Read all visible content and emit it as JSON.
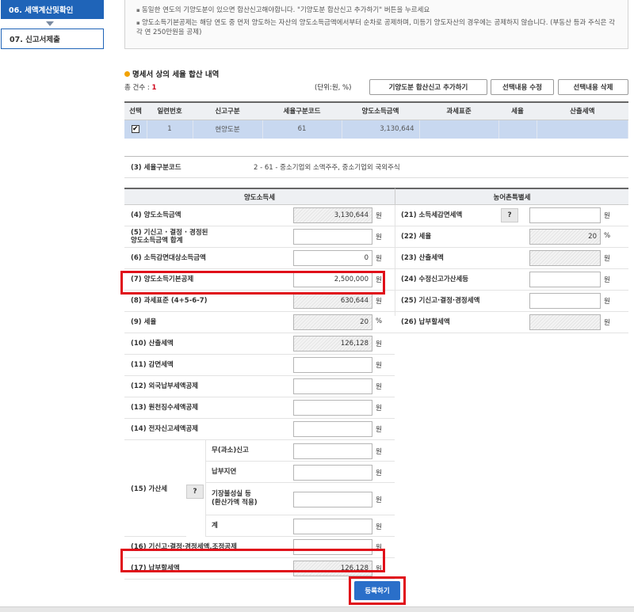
{
  "sidebar": {
    "step_active": "06. 세액계산및확인",
    "step_next": "07. 신고서제출"
  },
  "notice": {
    "line1": "동일한 연도의 기양도분이 있으면 합산신고해야합니다. \"기양도분 합산신고 추가하기\" 버튼을 누르세요",
    "line2": "양도소득기본공제는 해당 연도 중 먼저 양도하는 자산의 양도소득금액에서부터 순차로 공제하며, 미등기 양도자산의 경우에는 공제하지 않습니다. (부동산 등과 주식은 각각 연 250만원을 공제)"
  },
  "section": {
    "title": "명세서 상의 세율 합산 내역",
    "count_label": "총 건수 : ",
    "count_value": "1",
    "unit": "(단위:원, %)"
  },
  "buttons": {
    "add_prior": "기양도분 합산신고 추가하기",
    "edit_selected": "선택내용 수정",
    "delete_selected": "선택내용 삭제",
    "register": "등록하기"
  },
  "list": {
    "headers": [
      "선택",
      "일련번호",
      "신고구분",
      "세율구분코드",
      "양도소득금액",
      "과세표준",
      "세율",
      "산출세액"
    ],
    "row": {
      "checked": "✔",
      "serial": "1",
      "type": "현양도분",
      "rate_code": "61",
      "income": "3,130,644",
      "tax_base": "",
      "rate": "",
      "calc_tax": ""
    }
  },
  "rate_code_row": {
    "label": "(3) 세율구분코드",
    "value": "2 - 61 - 중소기업외 소액주주, 중소기업외 국외주식"
  },
  "form": {
    "left_header": "양도소득세",
    "right_header": "농어촌특별세",
    "won": "원",
    "pct": "%",
    "q": "?",
    "left": [
      {
        "label": "(4) 양도소득금액",
        "value": "3,130,644",
        "unit": "원",
        "ro": true
      },
      {
        "label": "(5) 기신고 · 결정 · 경정된\n양도소득금액 합계",
        "value": "",
        "unit": "원",
        "ro": false
      },
      {
        "label": "(6) 소득감면대상소득금액",
        "value": "0",
        "unit": "원",
        "ro": false
      },
      {
        "label": "(7) 양도소득기본공제",
        "value": "2,500,000",
        "unit": "원",
        "ro": false
      },
      {
        "label": "(8) 과세표준 (4+5-6-7)",
        "value": "630,644",
        "unit": "원",
        "ro": true
      },
      {
        "label": "(9) 세율",
        "value": "20",
        "unit": "%",
        "ro": true
      },
      {
        "label": "(10) 산출세액",
        "value": "126,128",
        "unit": "원",
        "ro": true
      },
      {
        "label": "(11) 감면세액",
        "value": "",
        "unit": "원",
        "ro": false
      },
      {
        "label": "(12) 외국납부세액공제",
        "value": "",
        "unit": "원",
        "ro": false
      },
      {
        "label": "(13) 원천징수세액공제",
        "value": "",
        "unit": "원",
        "ro": false
      },
      {
        "label": "(14) 전자신고세액공제",
        "value": "",
        "unit": "원",
        "ro": false
      }
    ],
    "penalty": {
      "label": "(15) 가산세",
      "items": [
        "무(과소)신고",
        "납부지연",
        "기장불성실 등\n(환산가액 적용)",
        "계"
      ]
    },
    "left_tail": [
      {
        "label": "(16) 기신고·결정·경정세액,조정공제",
        "value": "",
        "unit": "원",
        "ro": false
      },
      {
        "label": "(17) 납부할세액",
        "value": "126,128",
        "unit": "원",
        "ro": true
      }
    ],
    "right": [
      {
        "label": "(21) 소득세감면세액",
        "value": "",
        "unit": "원",
        "ro": false,
        "q": true
      },
      {
        "label": "(22) 세율",
        "value": "20",
        "unit": "%",
        "ro": true
      },
      {
        "label": "(23) 산출세액",
        "value": "",
        "unit": "원",
        "ro": true
      },
      {
        "label": "(24) 수정신고가산세등",
        "value": "",
        "unit": "원",
        "ro": false
      },
      {
        "label": "(25) 기신고·결정·경정세액",
        "value": "",
        "unit": "원",
        "ro": false
      },
      {
        "label": "(26) 납부할세액",
        "value": "",
        "unit": "원",
        "ro": true
      }
    ]
  },
  "colors": {
    "accent": "#1f64b8",
    "highlight": "#e0101a",
    "selected_row": "#c8d8f0"
  }
}
